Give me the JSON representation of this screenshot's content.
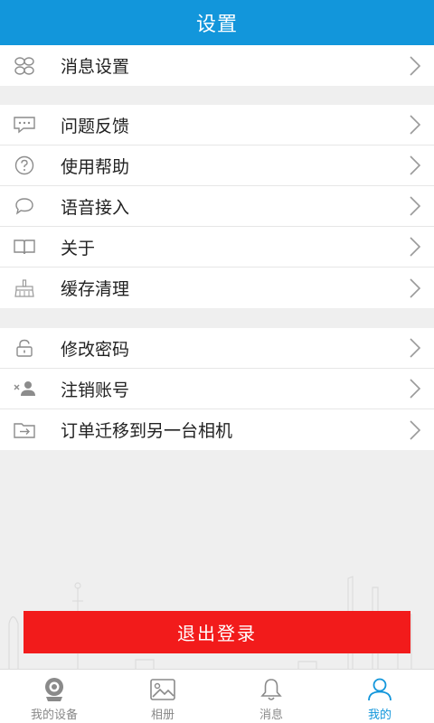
{
  "header": {
    "title": "设置"
  },
  "groups": [
    {
      "items": [
        {
          "label": "消息设置",
          "icon": "grid-icon"
        }
      ]
    },
    {
      "items": [
        {
          "label": "问题反馈",
          "icon": "chat-bubble-icon"
        },
        {
          "label": "使用帮助",
          "icon": "question-icon"
        },
        {
          "label": "语音接入",
          "icon": "speech-bubble-icon"
        },
        {
          "label": "关于",
          "icon": "book-icon"
        },
        {
          "label": "缓存清理",
          "icon": "broom-icon"
        }
      ]
    },
    {
      "items": [
        {
          "label": "修改密码",
          "icon": "lock-icon"
        },
        {
          "label": "注销账号",
          "icon": "remove-user-icon"
        },
        {
          "label": "订单迁移到另一台相机",
          "icon": "transfer-folder-icon"
        }
      ]
    }
  ],
  "logout": {
    "label": "退出登录"
  },
  "tabbar": {
    "tabs": [
      {
        "label": "我的设备",
        "icon": "camera-device-icon",
        "active": false
      },
      {
        "label": "相册",
        "icon": "photo-album-icon",
        "active": false
      },
      {
        "label": "消息",
        "icon": "bell-icon",
        "active": false
      },
      {
        "label": "我的",
        "icon": "person-icon",
        "active": true
      }
    ]
  },
  "colors": {
    "accent": "#1296db",
    "logout": "#f21b1b",
    "page_bg": "#efefef"
  }
}
